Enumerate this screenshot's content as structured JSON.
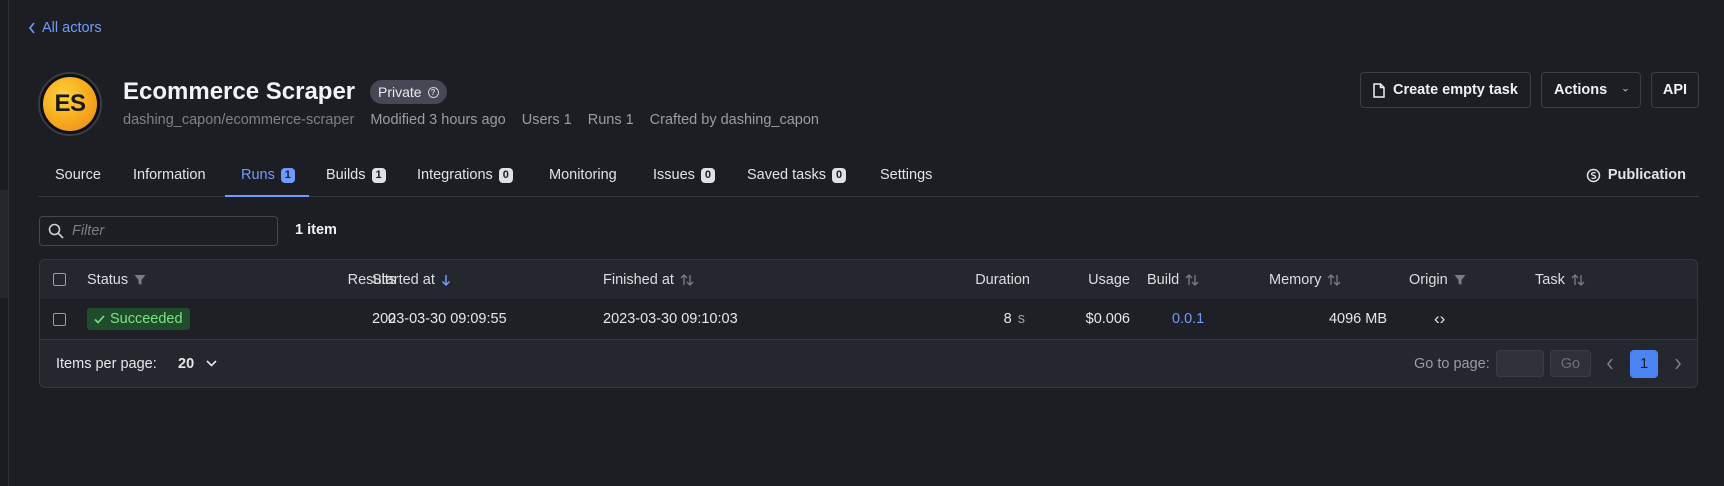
{
  "nav": {
    "back_label": "All actors"
  },
  "actor": {
    "avatar_initials": "ES",
    "name": "Ecommerce Scraper",
    "visibility": "Private",
    "path": "dashing_capon/ecommerce-scraper",
    "modified": "Modified 3 hours ago",
    "users": "Users 1",
    "runs": "Runs 1",
    "crafted_by": "Crafted by dashing_capon"
  },
  "toolbar": {
    "create_task_label": "Create empty task",
    "actions_label": "Actions",
    "api_label": "API"
  },
  "tabs": [
    {
      "label": "Source",
      "badge": ""
    },
    {
      "label": "Information",
      "badge": ""
    },
    {
      "label": "Runs",
      "badge": "1",
      "active": true
    },
    {
      "label": "Builds",
      "badge": "1"
    },
    {
      "label": "Integrations",
      "badge": "0"
    },
    {
      "label": "Monitoring",
      "badge": ""
    },
    {
      "label": "Issues",
      "badge": "0"
    },
    {
      "label": "Saved tasks",
      "badge": "0"
    },
    {
      "label": "Settings",
      "badge": ""
    }
  ],
  "publication_label": "Publication",
  "filter": {
    "placeholder": "Filter",
    "value": ""
  },
  "item_count": "1 item",
  "table": {
    "columns": {
      "status": "Status",
      "results": "Results",
      "started_at": "Started at",
      "finished_at": "Finished at",
      "duration": "Duration",
      "usage": "Usage",
      "build": "Build",
      "memory": "Memory",
      "origin": "Origin",
      "task": "Task"
    },
    "rows": [
      {
        "status": "Succeeded",
        "results": "0",
        "started_at": "2023-03-30 09:09:55",
        "finished_at": "2023-03-30 09:10:03",
        "duration_value": "8",
        "duration_unit": "s",
        "usage": "$0.006",
        "build": "0.0.1",
        "memory": "4096 MB",
        "origin": "‹›",
        "task": ""
      }
    ]
  },
  "pagination": {
    "items_per_page_label": "Items per page:",
    "items_per_page": "20",
    "goto_label": "Go to page:",
    "go_label": "Go",
    "current_page": "1"
  },
  "colors": {
    "background": "#1d1e24",
    "accent": "#6f9bff",
    "success_bg": "#1f4d2b",
    "success_text": "#7fe08a",
    "avatar": "#f6a81c"
  }
}
